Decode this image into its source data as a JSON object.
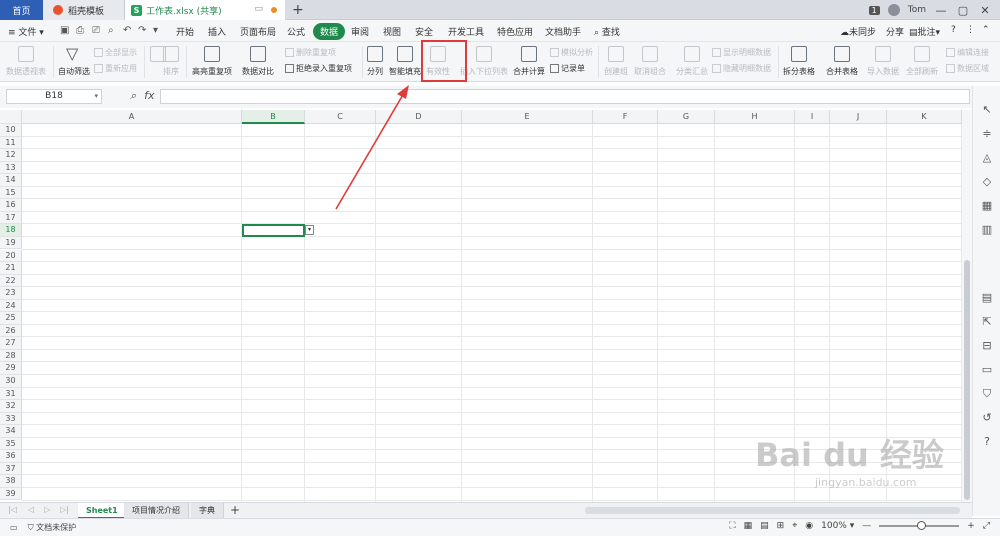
{
  "titlebar": {
    "home_tab": "首页",
    "store_tab": "稻壳模板",
    "doc_tab": "工作表.xlsx (共享)",
    "doc_icon": "S",
    "badge": "1",
    "user": "Tom"
  },
  "menubar": {
    "file": "文件",
    "items": [
      "开始",
      "插入",
      "页面布局",
      "公式",
      "数据",
      "审阅",
      "视图",
      "安全",
      "开发工具",
      "特色应用",
      "文档助手"
    ],
    "active": "数据",
    "search": "查找",
    "sync": "未同步",
    "share": "分享",
    "comment": "批注"
  },
  "ribbon": {
    "pivot": "数据透视表",
    "autofilter": "自动筛选",
    "showall": "全部显示",
    "reapply": "重新应用",
    "sort": "排序",
    "highlight_dup": "高亮重复项",
    "delete_dup": "删除重复项",
    "compare": "数据对比",
    "reject_dup": "拒绝录入重复项",
    "split": "分列",
    "smartfill": "智能填充",
    "validity": "有效性",
    "insert_dropdown": "插入下拉列表",
    "merge_calc": "合并计算",
    "sim_analysis": "模拟分析",
    "record": "记录单",
    "create_group": "创建组",
    "ungroup": "取消组合",
    "subtotal": "分类汇总",
    "show_detail": "显示明细数据",
    "hide_detail": "隐藏明细数据",
    "split_table": "拆分表格",
    "merge_table": "合并表格",
    "import": "导入数据",
    "refresh_all": "全部刷新",
    "edit_link": "编辑连接",
    "data_region": "数据区域"
  },
  "formula": {
    "namebox": "B18",
    "fx": "fx",
    "value": ""
  },
  "grid": {
    "columns": [
      "A",
      "B",
      "C",
      "D",
      "E",
      "F",
      "G",
      "H",
      "I",
      "J",
      "K"
    ],
    "selected_column": "B",
    "rows": [
      "10",
      "11",
      "12",
      "13",
      "14",
      "15",
      "16",
      "17",
      "18",
      "19",
      "20",
      "21",
      "22",
      "23",
      "24",
      "25",
      "26",
      "27",
      "28",
      "29",
      "30",
      "31",
      "32",
      "33",
      "34",
      "35",
      "36",
      "37",
      "38",
      "39"
    ],
    "selected_row": "18"
  },
  "sheets": {
    "tabs": [
      "Sheet1",
      "项目情况介绍",
      "字典"
    ],
    "active": "Sheet1"
  },
  "status": {
    "protect": "文档未保护",
    "zoom": "100%"
  },
  "watermark": {
    "brand": "Bai du 经验",
    "url": "jingyan.baidu.com"
  },
  "colors": {
    "accent": "#1f8a4c",
    "highlight_box": "#e03b3b",
    "home_tab": "#2e5fb5"
  }
}
